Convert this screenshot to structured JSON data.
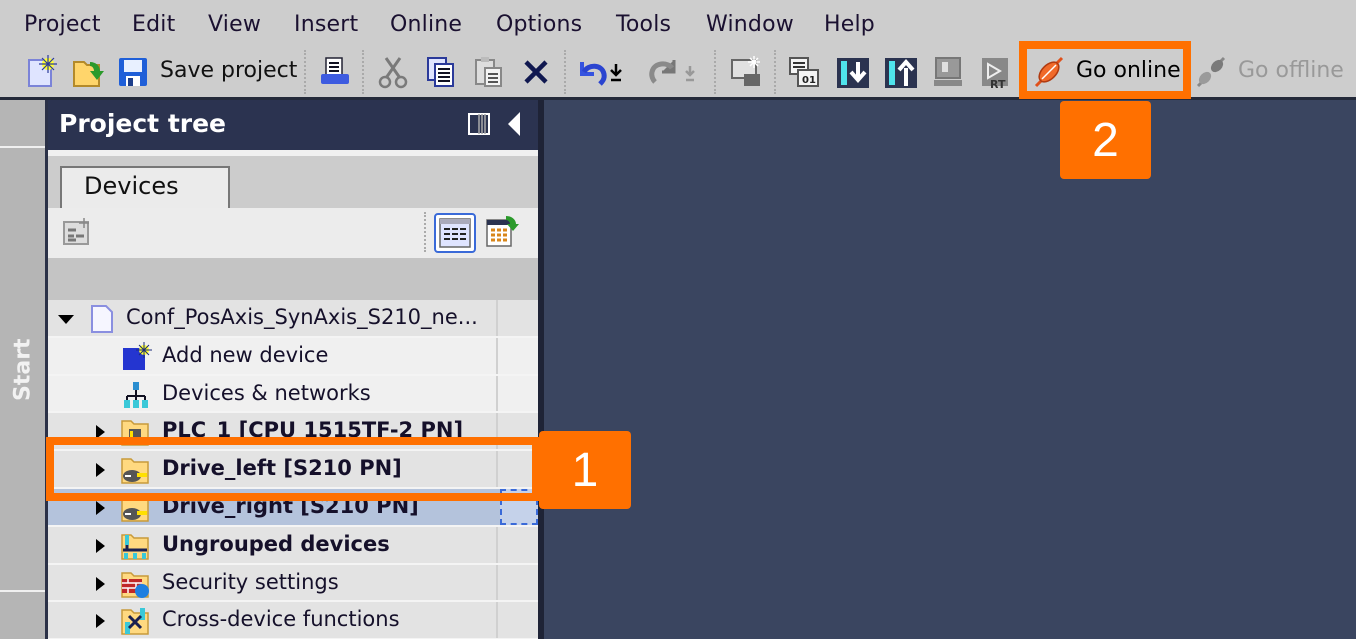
{
  "menubar": {
    "items": [
      "Project",
      "Edit",
      "View",
      "Insert",
      "Online",
      "Options",
      "Tools",
      "Window",
      "Help"
    ]
  },
  "toolbar": {
    "save_label": "Save project",
    "go_online_label": "Go online",
    "go_offline_label": "Go offline",
    "icons": [
      "new-project-icon",
      "open-project-icon",
      "save-icon",
      "print-icon",
      "cut-icon",
      "copy-icon",
      "paste-icon",
      "delete-icon",
      "undo-icon",
      "redo-icon",
      "compile-icon",
      "diagnostics-icon",
      "download-to-device-icon",
      "upload-from-device-icon",
      "simulation-icon",
      "runtime-icon",
      "go-online-icon",
      "go-offline-icon"
    ]
  },
  "startbar": {
    "label": "Start"
  },
  "project_tree": {
    "title": "Project tree",
    "tab": "Devices",
    "rows": [
      {
        "label": "Conf_PosAxis_SynAxis_S210_ne...",
        "icon": "project-file-icon",
        "expand": "expanded",
        "bold": false
      },
      {
        "label": "Add new device",
        "icon": "add-device-icon",
        "expand": "none",
        "bold": false
      },
      {
        "label": "Devices & networks",
        "icon": "network-icon",
        "expand": "none",
        "bold": false
      },
      {
        "label": "PLC_1 [CPU 1515TF-2 PN]",
        "icon": "plc-folder-icon",
        "expand": "collapsed",
        "bold": true
      },
      {
        "label": "Drive_left [S210 PN]",
        "icon": "drive-folder-icon",
        "expand": "collapsed",
        "bold": true
      },
      {
        "label": "Drive_right [S210 PN]",
        "icon": "drive-folder-icon",
        "expand": "collapsed",
        "bold": true,
        "selected": true
      },
      {
        "label": "Ungrouped devices",
        "icon": "ungrouped-folder-icon",
        "expand": "collapsed",
        "bold": true
      },
      {
        "label": "Security settings",
        "icon": "security-folder-icon",
        "expand": "collapsed",
        "bold": false
      },
      {
        "label": "Cross-device functions",
        "icon": "cross-device-folder-icon",
        "expand": "collapsed",
        "bold": false
      }
    ]
  },
  "annotations": {
    "step1": "1",
    "step2": "2",
    "accent_color": "#ff7000"
  }
}
